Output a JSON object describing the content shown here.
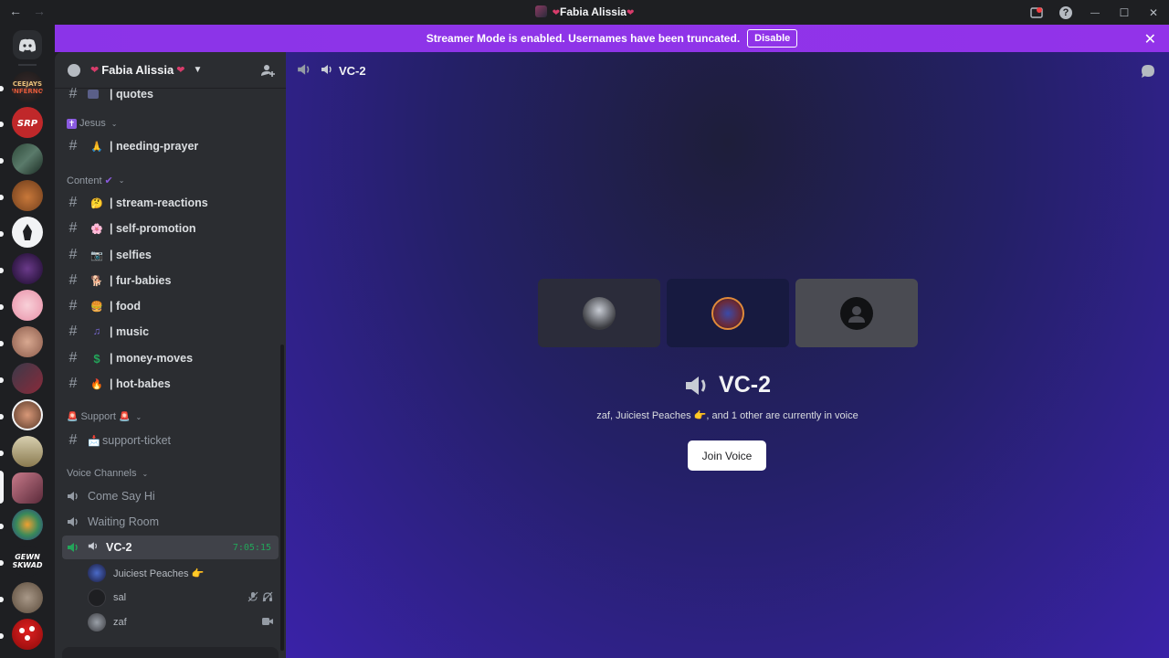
{
  "titlebar": {
    "title": "Fabia Alissia",
    "back": "←",
    "forward": "→",
    "help": "?",
    "minimize": "—",
    "maximize": "☐",
    "close": "✕"
  },
  "banner": {
    "text": "Streamer Mode is enabled. Usernames have been truncated.",
    "disable_label": "Disable",
    "close": "✕"
  },
  "server": {
    "name": "Fabia Alissia",
    "hearts": "❤"
  },
  "categories": {
    "jesus": "Jesus",
    "content": "Content",
    "support": "Support",
    "voice": "Voice Channels"
  },
  "channels": {
    "quotes": "| quotes",
    "needing_prayer": "| needing-prayer",
    "stream_reactions": "| stream-reactions",
    "self_promotion": "| self-promotion",
    "selfies": "| selfies",
    "fur_babies": "| fur-babies",
    "food": "| food",
    "music": "| music",
    "money_moves": "| money-moves",
    "hot_babes": "| hot-babes",
    "support_ticket": "support-ticket"
  },
  "voice_channels": {
    "come_say_hi": "Come Say Hi",
    "waiting_room": "Waiting Room",
    "vc2": "VC-2",
    "vc2_time": "7:05:15"
  },
  "voice_users": [
    "Juiciest Peaches 👉",
    "sal",
    "zaf"
  ],
  "main": {
    "header_title": "VC-2",
    "vc_title": "VC-2",
    "subtitle": "zaf, Juiciest Peaches 👉, and 1 other are currently in voice",
    "join_label": "Join Voice"
  },
  "colors": {
    "accent_purple": "#8b34e8",
    "online_green": "#23a55a",
    "sidebar_bg": "#2b2d31",
    "rail_bg": "#1e1f22"
  }
}
